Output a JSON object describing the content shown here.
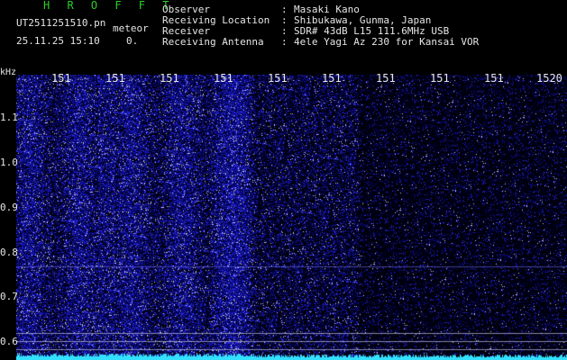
{
  "header": {
    "app_title": "H R O F F T",
    "file_name": "UT2511251510.pn",
    "tag": "meteor",
    "datetime": "25.11.25 15:10",
    "count": "0."
  },
  "station": [
    {
      "label": "Observer",
      "value": "Masaki Kano"
    },
    {
      "label": "Receiving Location",
      "value": "Shibukawa, Gunma, Japan"
    },
    {
      "label": "Receiver",
      "value": "SDR# 43dB L15 111.6MHz USB"
    },
    {
      "label": "Receiving Antenna",
      "value": "4ele Yagi Az 230 for Kansai VOR"
    }
  ],
  "axis": {
    "unit": "kHz",
    "x_ticks": [
      "151",
      "151",
      "151",
      "151",
      "151",
      "151",
      "151",
      "151",
      "151",
      "1520"
    ],
    "y_ticks": [
      "1.1",
      "1.0",
      "0.9",
      "0.8",
      "0.7",
      "0.6"
    ]
  },
  "colors": {
    "background": "#000000",
    "text": "#e6e6e6",
    "title_green": "#2bd02b",
    "signal_blue": "#2a2aff",
    "trace_cyan": "#33e0ff"
  }
}
